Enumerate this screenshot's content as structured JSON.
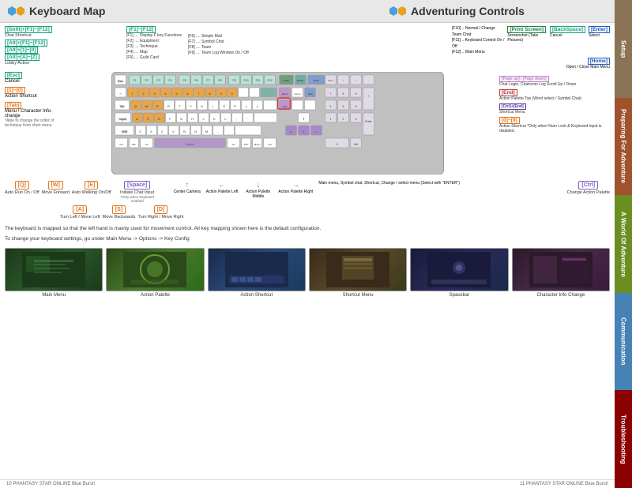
{
  "header": {
    "left_title": "Keyboard Map",
    "right_title": "Adventuring Controls",
    "hex_color_left": "#4a9eda",
    "hex_color_right": "#e8a020"
  },
  "sidebar": {
    "sections": [
      {
        "label": "Setup",
        "color": "#8b7355"
      },
      {
        "label": "Preparing For Adventure",
        "color": "#a0522d"
      },
      {
        "label": "A World Of Adventure",
        "color": "#6b8e23"
      },
      {
        "label": "Communication",
        "color": "#4682b4"
      },
      {
        "label": "Troubleshooting",
        "color": "#8b0000"
      }
    ]
  },
  "top_controls_left": {
    "shift_f1_f12": "[Shift]+[F1]~[F12]",
    "shift_desc": "Chat Shortcut",
    "alt_f1_f12": "[Alt]+[F1]~[F12]",
    "alt_1_0": "[Alt]+[1]~[0]",
    "alt_a_z": "[Alt]+[A]~[Z]",
    "alt_desc": "Lobby Action"
  },
  "top_controls_middle": {
    "f1_f12": "[F1]~[F12]",
    "f1_desc": "[F1] .... Display F key Functions",
    "f2_desc": "[F2] .... Equipment",
    "f3_desc": "[F3] .... Technique",
    "f4_desc": "[F4] .... Map",
    "f5_desc": "[F5] .... Guild Card",
    "f6_desc": "[F6] .... Simple Mail",
    "f7_desc": "[F7] .... Symbol Chat",
    "f8_desc": "[F8] .... Team",
    "f9_desc": "[F9] .... Team Log Window On / Off"
  },
  "top_controls_right": {
    "print_screen": "[Print Screen]",
    "print_desc": "Screenshot (Take Pictures)",
    "f10_desc": "[F10] .. Normal / Change Team Chat",
    "f11_desc": "[F11] .. Keyboard Control On / Off",
    "f12_desc": "[F12] .. Main Menu",
    "backspace": "[BackSpace]",
    "backspace_desc": "Cancel",
    "enter": "[Enter]",
    "enter_desc": "Select",
    "home": "[Home]",
    "home_desc": "Open / Close Main Menu"
  },
  "keyboard_labels": {
    "page_up_down": "[Page up] / [Page down]",
    "page_desc": "Chat Login, Chatroom Log Scroll Up / Down",
    "end": "[End]",
    "end_desc": "Action Palette Top (Word select / Symbol Chat)",
    "ctrl_end": "[Ctrl]+[End]",
    "ctrl_end_desc": "Shortcut Menu",
    "num_0_9": "[0]~[9]",
    "num_desc": "Action Shortcut *Only when Num Lock & Keyboard input is disabled."
  },
  "left_controls": [
    {
      "key": "[Esc]",
      "color": "teal",
      "desc": "Cancel"
    },
    {
      "key": "[1]~[0]",
      "color": "orange",
      "desc": "Action Shortcut"
    },
    {
      "key": "[Tab]",
      "color": "orange",
      "desc": "Menu / Character Info. change",
      "subdesc": "*Able to change the order of technique from short menu"
    }
  ],
  "bottom_controls": [
    {
      "key": "[Q]",
      "color": "orange",
      "desc": "Auto Run On / Off"
    },
    {
      "key": "[W]",
      "color": "orange",
      "desc": "Move Forward"
    },
    {
      "key": "[E]",
      "color": "orange",
      "desc": "Auto Walking On/Off"
    },
    {
      "key": "[Space]",
      "color": "purple",
      "desc": "Initiate Chat Input",
      "subdesc": "*Only when keyboard enabled"
    },
    {
      "key": "[Ctrl]",
      "color": "purple",
      "desc": "Change Action Palette"
    }
  ],
  "bottom_controls2": [
    {
      "key": "[A]",
      "color": "orange",
      "desc": "Turn Left / Move Left"
    },
    {
      "key": "[S]",
      "color": "orange",
      "desc": "Move Backwards"
    },
    {
      "key": "[D]",
      "color": "orange",
      "desc": "Turn Right / Move Right"
    }
  ],
  "arrow_controls": {
    "up": "↑",
    "left": "←",
    "down": "↓",
    "right": "→",
    "center_desc": "Center Camera",
    "left_desc": "Action Palette Left",
    "down_desc": "Action Palette Middle",
    "right_desc": "Action Palette Right"
  },
  "right_controls": {
    "up_desc": "Main menu, Symbol chat, Shortcut, Change / select menu (Select with \"ENTER\")"
  },
  "info_texts": [
    "The keyboard is mapped so that the left hand is mainly used for movement control.   All key mapping shown here is the default configuration.",
    "To change your keyboard settings, go under Main Menu -> Options -> Key Config"
  ],
  "screenshots": [
    {
      "label": "Main Menu",
      "bg": "ss-1"
    },
    {
      "label": "Action Palette",
      "bg": "ss-2"
    },
    {
      "label": "Action Shortcut",
      "bg": "ss-3"
    },
    {
      "label": "Shortcut Menu",
      "bg": "ss-4"
    },
    {
      "label": "Spacebar",
      "bg": "ss-5"
    },
    {
      "label": "Character Info Change",
      "bg": "ss-6"
    }
  ],
  "footer": {
    "left_page": "10",
    "left_game": "PHANTASY STAR ONLINE Blue Burst!",
    "right_page": "11",
    "right_game": "PHANTASY STAR ONLINE Blue Burst!"
  }
}
